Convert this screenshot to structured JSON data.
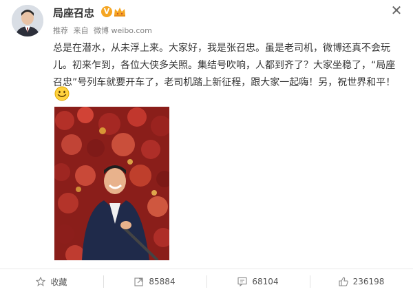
{
  "user": {
    "name": "局座召忠",
    "verified_badge": "V",
    "avatar_icon": "avatar-photo",
    "crown_icon": "crown-icon"
  },
  "meta": {
    "tag": "推荐",
    "source_prefix": "来自",
    "source": "微博 weibo.com"
  },
  "post": {
    "lines": [
      "总是在潜水，从未浮上来。大家好，我是张召忠。虽是老司机，微博还真不会玩",
      "儿。初来乍到，各位大侠多关照。集结号吹响，人都到齐了？大家坐稳了，“局座",
      "召忠”号列车就要开车了，老司机踏上新征程，跟大家一起嗨！另，祝世界和平！"
    ],
    "emoji": "smile-emoji"
  },
  "footer": {
    "favorite_label": "收藏",
    "repost_count": "85884",
    "comment_count": "68104",
    "like_count": "236198"
  },
  "colors": {
    "badge": "#f5a623",
    "text": "#333333",
    "meta": "#808080",
    "divider": "#eaeaea"
  }
}
